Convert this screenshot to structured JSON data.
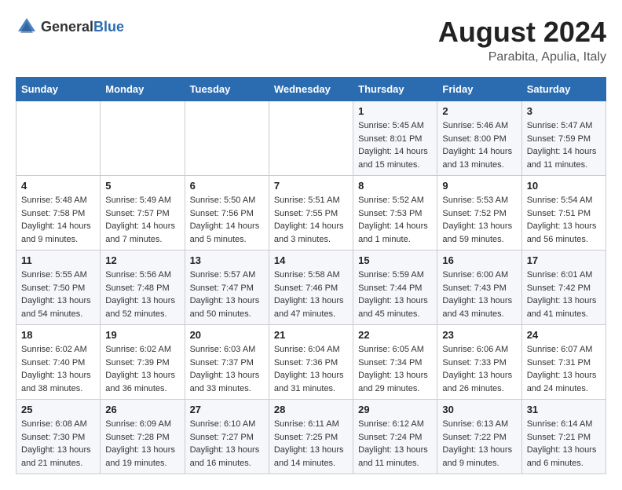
{
  "logo": {
    "general": "General",
    "blue": "Blue"
  },
  "title": {
    "month_year": "August 2024",
    "location": "Parabita, Apulia, Italy"
  },
  "header_days": [
    "Sunday",
    "Monday",
    "Tuesday",
    "Wednesday",
    "Thursday",
    "Friday",
    "Saturday"
  ],
  "weeks": [
    [
      {
        "day": "",
        "info": ""
      },
      {
        "day": "",
        "info": ""
      },
      {
        "day": "",
        "info": ""
      },
      {
        "day": "",
        "info": ""
      },
      {
        "day": "1",
        "info": "Sunrise: 5:45 AM\nSunset: 8:01 PM\nDaylight: 14 hours\nand 15 minutes."
      },
      {
        "day": "2",
        "info": "Sunrise: 5:46 AM\nSunset: 8:00 PM\nDaylight: 14 hours\nand 13 minutes."
      },
      {
        "day": "3",
        "info": "Sunrise: 5:47 AM\nSunset: 7:59 PM\nDaylight: 14 hours\nand 11 minutes."
      }
    ],
    [
      {
        "day": "4",
        "info": "Sunrise: 5:48 AM\nSunset: 7:58 PM\nDaylight: 14 hours\nand 9 minutes."
      },
      {
        "day": "5",
        "info": "Sunrise: 5:49 AM\nSunset: 7:57 PM\nDaylight: 14 hours\nand 7 minutes."
      },
      {
        "day": "6",
        "info": "Sunrise: 5:50 AM\nSunset: 7:56 PM\nDaylight: 14 hours\nand 5 minutes."
      },
      {
        "day": "7",
        "info": "Sunrise: 5:51 AM\nSunset: 7:55 PM\nDaylight: 14 hours\nand 3 minutes."
      },
      {
        "day": "8",
        "info": "Sunrise: 5:52 AM\nSunset: 7:53 PM\nDaylight: 14 hours\nand 1 minute."
      },
      {
        "day": "9",
        "info": "Sunrise: 5:53 AM\nSunset: 7:52 PM\nDaylight: 13 hours\nand 59 minutes."
      },
      {
        "day": "10",
        "info": "Sunrise: 5:54 AM\nSunset: 7:51 PM\nDaylight: 13 hours\nand 56 minutes."
      }
    ],
    [
      {
        "day": "11",
        "info": "Sunrise: 5:55 AM\nSunset: 7:50 PM\nDaylight: 13 hours\nand 54 minutes."
      },
      {
        "day": "12",
        "info": "Sunrise: 5:56 AM\nSunset: 7:48 PM\nDaylight: 13 hours\nand 52 minutes."
      },
      {
        "day": "13",
        "info": "Sunrise: 5:57 AM\nSunset: 7:47 PM\nDaylight: 13 hours\nand 50 minutes."
      },
      {
        "day": "14",
        "info": "Sunrise: 5:58 AM\nSunset: 7:46 PM\nDaylight: 13 hours\nand 47 minutes."
      },
      {
        "day": "15",
        "info": "Sunrise: 5:59 AM\nSunset: 7:44 PM\nDaylight: 13 hours\nand 45 minutes."
      },
      {
        "day": "16",
        "info": "Sunrise: 6:00 AM\nSunset: 7:43 PM\nDaylight: 13 hours\nand 43 minutes."
      },
      {
        "day": "17",
        "info": "Sunrise: 6:01 AM\nSunset: 7:42 PM\nDaylight: 13 hours\nand 41 minutes."
      }
    ],
    [
      {
        "day": "18",
        "info": "Sunrise: 6:02 AM\nSunset: 7:40 PM\nDaylight: 13 hours\nand 38 minutes."
      },
      {
        "day": "19",
        "info": "Sunrise: 6:02 AM\nSunset: 7:39 PM\nDaylight: 13 hours\nand 36 minutes."
      },
      {
        "day": "20",
        "info": "Sunrise: 6:03 AM\nSunset: 7:37 PM\nDaylight: 13 hours\nand 33 minutes."
      },
      {
        "day": "21",
        "info": "Sunrise: 6:04 AM\nSunset: 7:36 PM\nDaylight: 13 hours\nand 31 minutes."
      },
      {
        "day": "22",
        "info": "Sunrise: 6:05 AM\nSunset: 7:34 PM\nDaylight: 13 hours\nand 29 minutes."
      },
      {
        "day": "23",
        "info": "Sunrise: 6:06 AM\nSunset: 7:33 PM\nDaylight: 13 hours\nand 26 minutes."
      },
      {
        "day": "24",
        "info": "Sunrise: 6:07 AM\nSunset: 7:31 PM\nDaylight: 13 hours\nand 24 minutes."
      }
    ],
    [
      {
        "day": "25",
        "info": "Sunrise: 6:08 AM\nSunset: 7:30 PM\nDaylight: 13 hours\nand 21 minutes."
      },
      {
        "day": "26",
        "info": "Sunrise: 6:09 AM\nSunset: 7:28 PM\nDaylight: 13 hours\nand 19 minutes."
      },
      {
        "day": "27",
        "info": "Sunrise: 6:10 AM\nSunset: 7:27 PM\nDaylight: 13 hours\nand 16 minutes."
      },
      {
        "day": "28",
        "info": "Sunrise: 6:11 AM\nSunset: 7:25 PM\nDaylight: 13 hours\nand 14 minutes."
      },
      {
        "day": "29",
        "info": "Sunrise: 6:12 AM\nSunset: 7:24 PM\nDaylight: 13 hours\nand 11 minutes."
      },
      {
        "day": "30",
        "info": "Sunrise: 6:13 AM\nSunset: 7:22 PM\nDaylight: 13 hours\nand 9 minutes."
      },
      {
        "day": "31",
        "info": "Sunrise: 6:14 AM\nSunset: 7:21 PM\nDaylight: 13 hours\nand 6 minutes."
      }
    ]
  ]
}
